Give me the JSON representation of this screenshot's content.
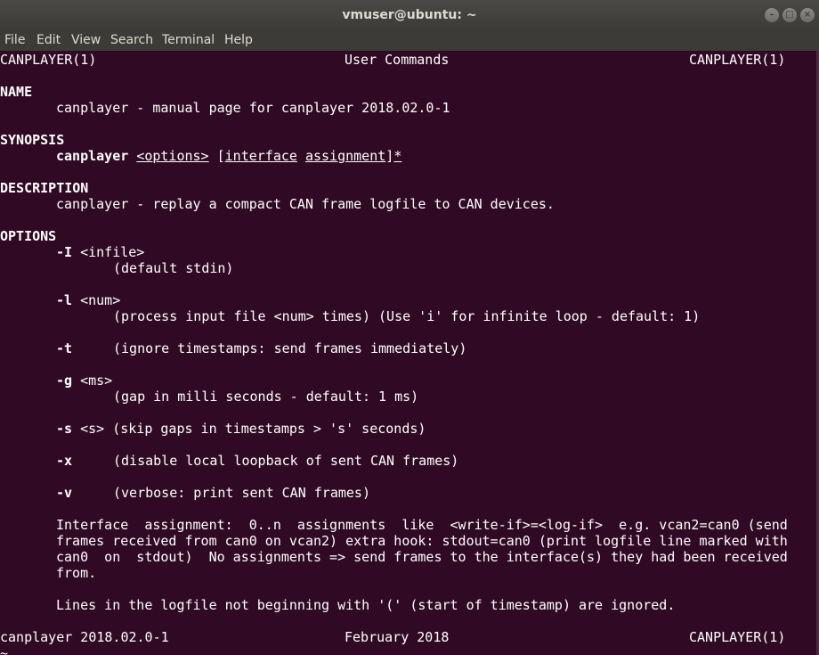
{
  "window": {
    "title": "vmuser@ubuntu: ~"
  },
  "titlebar_buttons": {
    "minimize": "–",
    "maximize": "□",
    "close": "×"
  },
  "menu": [
    "File",
    "Edit",
    "View",
    "Search",
    "Terminal",
    "Help"
  ],
  "header": {
    "left": "CANPLAYER(1)",
    "center": "User Commands",
    "right": "CANPLAYER(1)"
  },
  "sections": {
    "name": "NAME",
    "synopsis": "SYNOPSIS",
    "description": "DESCRIPTION",
    "options": "OPTIONS"
  },
  "name_text": "canplayer - manual page for canplayer 2018.02.0-1",
  "synopsis": {
    "command": "canplayer",
    "options": "<options>",
    "bracket_open": "[",
    "interface": "interface",
    "assignment": "assignment",
    "bracket_close": "]",
    "star": "*"
  },
  "description_text": "canplayer - replay a compact CAN frame logfile to CAN devices.",
  "options": {
    "I_flag": "-I",
    "I_arg": "<infile>",
    "I_desc": "(default stdin)",
    "l_flag": "-l",
    "l_arg": "<num>",
    "l_desc": "(process input file <num> times) (Use 'i' for infinite loop - default: 1)",
    "t_flag": "-t",
    "t_desc": "(ignore timestamps: send frames immediately)",
    "g_flag": "-g",
    "g_arg": "<ms>",
    "g_desc": "(gap in milli seconds - default: 1 ms)",
    "s_flag": "-s",
    "s_rest": "<s> (skip gaps in timestamps > 's' seconds)",
    "x_flag": "-x",
    "x_desc": "(disable local loopback of sent CAN frames)",
    "v_flag": "-v",
    "v_desc": "(verbose: print sent CAN frames)"
  },
  "interface_paragraph": [
    "Interface  assignment:  0..n  assignments  like  <write-if>=<log-if>  e.g. vcan2=can0 (send",
    "frames received from can0 on vcan2) extra hook: stdout=can0 (print logfile line marked with",
    "can0  on  stdout)  No assignments => send frames to the interface(s) they had been received",
    "from."
  ],
  "logfile_note": "Lines in the logfile not beginning with '(' (start of timestamp) are ignored.",
  "footer": {
    "left": "canplayer 2018.02.0-1",
    "center": "February 2018",
    "right": "CANPLAYER(1)"
  },
  "prompt_tilde": "~"
}
